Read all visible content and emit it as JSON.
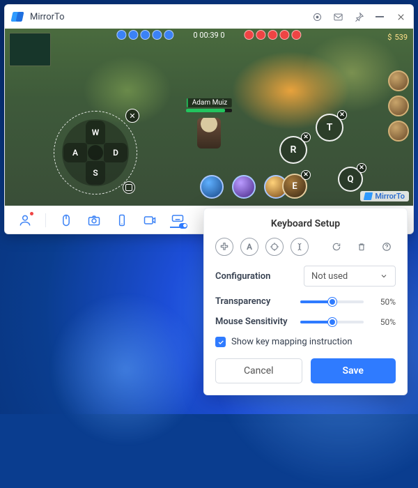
{
  "app": {
    "title": "MirrorTo"
  },
  "game": {
    "playerName": "Adam Muiz",
    "gold": "539",
    "score": "0   00:39   0",
    "dpad": {
      "up": "W",
      "down": "S",
      "left": "A",
      "right": "D"
    },
    "keys": {
      "r": "R",
      "t": "T",
      "e": "E",
      "q": "Q"
    },
    "watermark": "MirrorTo"
  },
  "panel": {
    "title": "Keyboard Setup",
    "configLabel": "Configuration",
    "configValue": "Not used",
    "transparencyLabel": "Transparency",
    "transparencyValue": "50%",
    "transparencyPct": 50,
    "sensitivityLabel": "Mouse Sensitivity",
    "sensitivityValue": "50%",
    "sensitivityPct": 50,
    "showMappingLabel": "Show key mapping instruction",
    "cancel": "Cancel",
    "save": "Save"
  }
}
